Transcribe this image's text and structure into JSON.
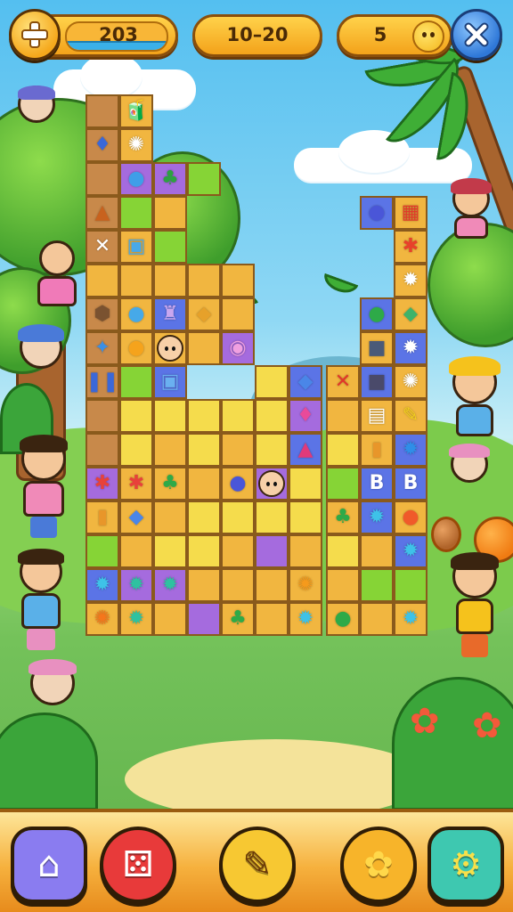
{
  "hud": {
    "score_value": "203",
    "level_value": "10–20",
    "lives_value": "5",
    "plus_icon": "plus-icon",
    "close_icon": "close-x-icon",
    "smiley_icon": "smiley-icon"
  },
  "board": {
    "tiles": [
      {
        "glyph": "🧃",
        "color": "#4fc3a0"
      },
      {
        "glyph": "♦",
        "color": "#3b68d8"
      },
      {
        "glyph": "✺",
        "color": "#ffffff"
      },
      {
        "glyph": "●",
        "color": "#3f9ee8"
      },
      {
        "glyph": "♣",
        "color": "#2ea043"
      },
      {
        "glyph": "●",
        "color": "#4a56d8"
      },
      {
        "glyph": "▦",
        "color": "#e23a2a"
      },
      {
        "glyph": "▲",
        "color": "#c8621e"
      },
      {
        "glyph": "✱",
        "color": "#e8412a"
      },
      {
        "glyph": "✕",
        "color": "#ffffff"
      },
      {
        "glyph": "▣",
        "color": "#49a9e8"
      },
      {
        "glyph": "✹",
        "color": "#ffffff"
      },
      {
        "glyph": "●",
        "color": "#2eaa48"
      },
      {
        "glyph": "⬥",
        "color": "#3fb36a"
      },
      {
        "glyph": "⬢",
        "color": "#7a5230"
      },
      {
        "glyph": "●",
        "color": "#46a9e8"
      },
      {
        "glyph": "♜",
        "color": "#c9a7ef"
      },
      {
        "glyph": "◆",
        "color": "#e6a12a"
      },
      {
        "glyph": "■",
        "color": "#4a5a78"
      },
      {
        "glyph": "✹",
        "color": "#ffffff"
      },
      {
        "glyph": "✦",
        "color": "#3b8fe6"
      },
      {
        "glyph": "●",
        "color": "#f5a31c"
      },
      {
        "glyph": "◉",
        "color": "#f0a0e0"
      },
      {
        "glyph": "✕",
        "color": "#e2362a"
      },
      {
        "glyph": "■",
        "color": "#4a4a6a"
      },
      {
        "glyph": "✺",
        "color": "#ffffff"
      },
      {
        "glyph": "❚❚",
        "color": "#3b68d8"
      },
      {
        "glyph": "▣",
        "color": "#6ab0f0"
      },
      {
        "glyph": "◆",
        "color": "#4a86e8"
      },
      {
        "glyph": "▤",
        "color": "#ffffff"
      },
      {
        "glyph": "✎",
        "color": "#f5d21c"
      },
      {
        "glyph": "♦",
        "color": "#e84a9a"
      },
      {
        "glyph": "▮",
        "color": "#e8962a"
      },
      {
        "glyph": "✹",
        "color": "#2f8ee8"
      },
      {
        "glyph": "▲",
        "color": "#e03a7a"
      },
      {
        "glyph": "◭",
        "color": "#4a86e8"
      },
      {
        "glyph": "B",
        "color": "#ffffff"
      },
      {
        "glyph": "B",
        "color": "#ffffff"
      },
      {
        "glyph": "✱",
        "color": "#e8413a"
      },
      {
        "glyph": "✱",
        "color": "#e8413a"
      },
      {
        "glyph": "♣",
        "color": "#2eaa48"
      },
      {
        "glyph": "●",
        "color": "#4a56d8"
      },
      {
        "glyph": "♣",
        "color": "#2eaa48"
      },
      {
        "glyph": "✹",
        "color": "#3ec2e8"
      },
      {
        "glyph": "●",
        "color": "#f05a2a"
      },
      {
        "glyph": "▮",
        "color": "#e8962a"
      },
      {
        "glyph": "◆",
        "color": "#4a86e8"
      },
      {
        "glyph": "✹",
        "color": "#3ec2e8"
      },
      {
        "glyph": "✹",
        "color": "#3ec2e8"
      },
      {
        "glyph": "✹",
        "color": "#2ec2a0"
      },
      {
        "glyph": "✹",
        "color": "#2ec2a0"
      },
      {
        "glyph": "✺",
        "color": "#f59a1c"
      },
      {
        "glyph": "●",
        "color": "#2eaa48"
      },
      {
        "glyph": "✺",
        "color": "#f5761c"
      },
      {
        "glyph": "✹",
        "color": "#2ec2a0"
      },
      {
        "glyph": "♣",
        "color": "#2eaa48"
      },
      {
        "glyph": "✹",
        "color": "#3ec2e8"
      },
      {
        "glyph": "✹",
        "color": "#3ec2e8"
      }
    ]
  },
  "bottom_nav": {
    "items": [
      {
        "icon": "home-icon",
        "glyph": "⌂",
        "color": "#8a7cf0"
      },
      {
        "icon": "dice-icon",
        "glyph": "⚄",
        "color": "#e83a3a"
      },
      {
        "icon": "brush-icon",
        "glyph": "✎",
        "color": "#f7c832"
      },
      {
        "icon": "flower-settings-icon",
        "glyph": "✿",
        "color": "#f7b42a"
      },
      {
        "icon": "magnifier-gear-icon",
        "glyph": "⚙",
        "color": "#3ec8b0"
      }
    ]
  },
  "colors": {
    "board_border": "#8a5a1c",
    "hud_orange": "#f3a21a",
    "sky": "#54bff0",
    "grass": "#74c25a"
  }
}
